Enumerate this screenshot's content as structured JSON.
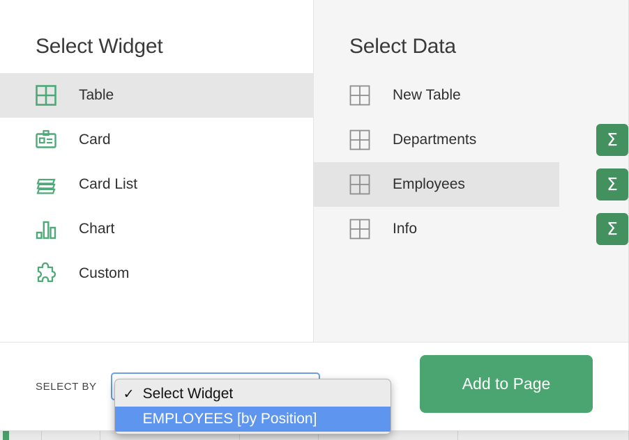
{
  "widget_panel": {
    "title": "Select Widget",
    "items": [
      {
        "label": "Table",
        "icon": "table-grid-icon",
        "selected": true
      },
      {
        "label": "Card",
        "icon": "id-card-icon",
        "selected": false
      },
      {
        "label": "Card List",
        "icon": "stacked-list-icon",
        "selected": false
      },
      {
        "label": "Chart",
        "icon": "bar-chart-icon",
        "selected": false
      },
      {
        "label": "Custom",
        "icon": "puzzle-piece-icon",
        "selected": false
      }
    ]
  },
  "data_panel": {
    "title": "Select Data",
    "items": [
      {
        "label": "New Table",
        "icon": "table-grid-icon",
        "selected": false,
        "sigma": false
      },
      {
        "label": "Departments",
        "icon": "table-grid-icon",
        "selected": false,
        "sigma": true
      },
      {
        "label": "Employees",
        "icon": "table-grid-icon",
        "selected": true,
        "sigma": true
      },
      {
        "label": "Info",
        "icon": "table-grid-icon",
        "selected": false,
        "sigma": true
      }
    ],
    "sigma_label": "Σ"
  },
  "footer": {
    "select_by_label": "SELECT BY",
    "dropdown": {
      "value": "Select Widget",
      "options": [
        {
          "label": "Select Widget",
          "checked": true,
          "highlighted": false
        },
        {
          "label": "EMPLOYEES [by Position]",
          "checked": false,
          "highlighted": true
        }
      ]
    },
    "add_button_label": "Add to Page"
  },
  "colors": {
    "accent_green": "#4aa571",
    "sigma_green": "#449160",
    "icon_green": "#4fa878",
    "selection_blue": "#5d95ef",
    "panel_gray": "#f5f5f5",
    "row_selected_gray": "#e6e6e6"
  }
}
